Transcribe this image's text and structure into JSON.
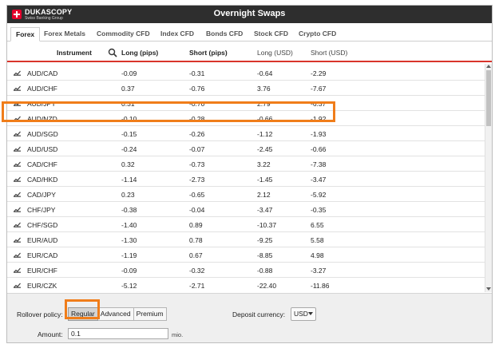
{
  "window": {
    "title": "Overnight Swaps",
    "logo_name": "DUKASCOPY",
    "logo_sub": "Swiss Banking Group"
  },
  "tabs": [
    {
      "label": "Forex",
      "active": true
    },
    {
      "label": "Forex Metals",
      "active": false
    },
    {
      "label": "Commodity CFD",
      "active": false
    },
    {
      "label": "Index CFD",
      "active": false
    },
    {
      "label": "Bonds CFD",
      "active": false
    },
    {
      "label": "Stock CFD",
      "active": false
    },
    {
      "label": "Crypto CFD",
      "active": false
    }
  ],
  "table": {
    "headers": {
      "instrument": "Instrument",
      "long_pips": "Long (pips)",
      "short_pips": "Short (pips)",
      "long_usd": "Long (USD)",
      "short_usd": "Short (USD)"
    },
    "rows": [
      {
        "instrument": "AUD/CAD",
        "long_pips": "-0.09",
        "short_pips": "-0.31",
        "long_usd": "-0.64",
        "short_usd": "-2.29"
      },
      {
        "instrument": "AUD/CHF",
        "long_pips": "0.37",
        "short_pips": "-0.76",
        "long_usd": "3.76",
        "short_usd": "-7.67"
      },
      {
        "instrument": "AUD/JPY",
        "long_pips": "0.31",
        "short_pips": "-0.70",
        "long_usd": "2.79",
        "short_usd": "-6.37"
      },
      {
        "instrument": "AUD/NZD",
        "long_pips": "-0.10",
        "short_pips": "-0.28",
        "long_usd": "-0.66",
        "short_usd": "-1.92"
      },
      {
        "instrument": "AUD/SGD",
        "long_pips": "-0.15",
        "short_pips": "-0.26",
        "long_usd": "-1.12",
        "short_usd": "-1.93"
      },
      {
        "instrument": "AUD/USD",
        "long_pips": "-0.24",
        "short_pips": "-0.07",
        "long_usd": "-2.45",
        "short_usd": "-0.66"
      },
      {
        "instrument": "CAD/CHF",
        "long_pips": "0.32",
        "short_pips": "-0.73",
        "long_usd": "3.22",
        "short_usd": "-7.38"
      },
      {
        "instrument": "CAD/HKD",
        "long_pips": "-1.14",
        "short_pips": "-2.73",
        "long_usd": "-1.45",
        "short_usd": "-3.47"
      },
      {
        "instrument": "CAD/JPY",
        "long_pips": "0.23",
        "short_pips": "-0.65",
        "long_usd": "2.12",
        "short_usd": "-5.92"
      },
      {
        "instrument": "CHF/JPY",
        "long_pips": "-0.38",
        "short_pips": "-0.04",
        "long_usd": "-3.47",
        "short_usd": "-0.35"
      },
      {
        "instrument": "CHF/SGD",
        "long_pips": "-1.40",
        "short_pips": "0.89",
        "long_usd": "-10.37",
        "short_usd": "6.55"
      },
      {
        "instrument": "EUR/AUD",
        "long_pips": "-1.30",
        "short_pips": "0.78",
        "long_usd": "-9.25",
        "short_usd": "5.58"
      },
      {
        "instrument": "EUR/CAD",
        "long_pips": "-1.19",
        "short_pips": "0.67",
        "long_usd": "-8.85",
        "short_usd": "4.98"
      },
      {
        "instrument": "EUR/CHF",
        "long_pips": "-0.09",
        "short_pips": "-0.32",
        "long_usd": "-0.88",
        "short_usd": "-3.27"
      },
      {
        "instrument": "EUR/CZK",
        "long_pips": "-5.12",
        "short_pips": "-2.71",
        "long_usd": "-22.40",
        "short_usd": "-11.86"
      }
    ]
  },
  "footer": {
    "rollover_label": "Rollover policy:",
    "policies": [
      {
        "label": "Regular",
        "active": true
      },
      {
        "label": "Advanced",
        "active": false
      },
      {
        "label": "Premium",
        "active": false
      }
    ],
    "deposit_label": "Deposit currency:",
    "deposit_value": "USD",
    "amount_label": "Amount:",
    "amount_value": "0.1",
    "amount_unit": "mio."
  },
  "colors": {
    "titlebar": "#2e2e2e",
    "header_underline": "#d9342b",
    "highlight": "#f07d1a",
    "logo_red": "#e4002b"
  },
  "icons": {
    "search": "search-icon",
    "row_chart": "chart-icon",
    "logo": "swiss-cross-icon"
  }
}
